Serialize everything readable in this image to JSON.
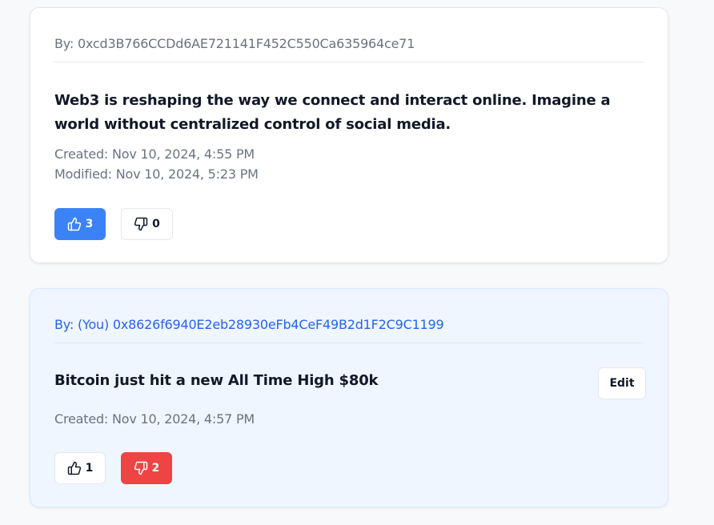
{
  "posts": [
    {
      "author": "By: 0xcd3B766CCDd6AE721141F452C550Ca635964ce71",
      "content": "Web3 is reshaping the way we connect and interact online. Imagine a world without centralized control of social media.",
      "created": "Created: Nov 10, 2024, 4:55 PM",
      "modified": "Modified: Nov 10, 2024, 5:23 PM",
      "likes": "3",
      "dislikes": "0"
    },
    {
      "author": "By: (You) 0x8626f6940E2eb28930eFb4CeF49B2d1F2C9C1199",
      "content": "Bitcoin just hit a new All Time High $80k",
      "created": "Created: Nov 10, 2024, 4:57 PM",
      "edit_label": "Edit",
      "likes": "1",
      "dislikes": "2"
    }
  ],
  "colors": {
    "like_active": "#3b82f6",
    "dislike_active": "#ef4444",
    "own_post_bg": "#eff6ff",
    "own_author_text": "#2563eb"
  },
  "icons": {
    "like": "thumbs-up-icon",
    "dislike": "thumbs-down-icon"
  }
}
